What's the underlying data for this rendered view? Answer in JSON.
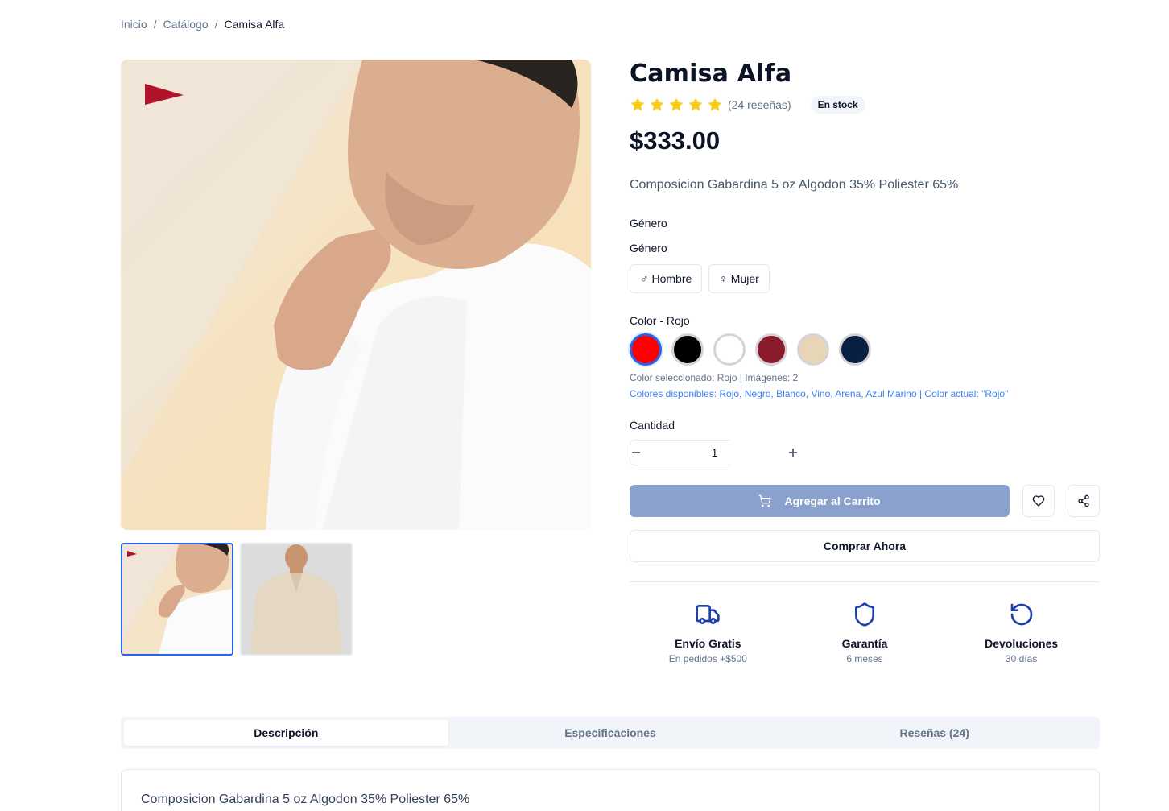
{
  "breadcrumb": {
    "home": "Inicio",
    "catalog": "Catálogo",
    "current": "Camisa Alfa",
    "separator": "/"
  },
  "product": {
    "title": "Camisa Alfa",
    "rating": 5,
    "reviews": "(24 reseñas)",
    "stock_badge": "En stock",
    "price": "$333.00",
    "description": "Composicion Gabardina 5 oz Algodon 35% Poliester 65%"
  },
  "gender": {
    "label_1": "Género",
    "label_2": "Género",
    "options": [
      {
        "symbol": "♂",
        "label": "Hombre"
      },
      {
        "symbol": "♀",
        "label": "Mujer"
      }
    ]
  },
  "color": {
    "label": "Color - Rojo",
    "swatches": [
      {
        "name": "Rojo",
        "hex": "#ff0000",
        "selected": true
      },
      {
        "name": "Negro",
        "hex": "#000000"
      },
      {
        "name": "Blanco",
        "hex": "#ffffff"
      },
      {
        "name": "Vino",
        "hex": "#8b1a2b"
      },
      {
        "name": "Arena",
        "hex": "#e8d5b5"
      },
      {
        "name": "Azul Marino",
        "hex": "#0a1f44"
      }
    ],
    "selected_info": "Color seleccionado: Rojo | Imágenes: 2",
    "available_info": "Colores disponibles: Rojo, Negro, Blanco, Vino, Arena, Azul Marino | Color actual: \"Rojo\""
  },
  "quantity": {
    "label": "Cantidad",
    "value": "1",
    "minus": "−",
    "plus": "+"
  },
  "actions": {
    "add_to_cart": "Agregar al Carrito",
    "buy_now": "Comprar Ahora"
  },
  "features": [
    {
      "icon": "truck-icon",
      "title": "Envío Gratis",
      "subtitle": "En pedidos +$500"
    },
    {
      "icon": "shield-icon",
      "title": "Garantía",
      "subtitle": "6 meses"
    },
    {
      "icon": "rotate-ccw-icon",
      "title": "Devoluciones",
      "subtitle": "30 días"
    }
  ],
  "tabs": [
    {
      "label": "Descripción",
      "active": true
    },
    {
      "label": "Especificaciones"
    },
    {
      "label": "Reseñas (24)"
    }
  ],
  "tab_content": "Composicion Gabardina 5 oz Algodon 35% Poliester 65%",
  "colors": {
    "accent": "#2563eb",
    "star": "#facc15",
    "cart_button": "#8aa0cd",
    "icon_blue": "#1e40af",
    "pennant": "#b0122a"
  }
}
